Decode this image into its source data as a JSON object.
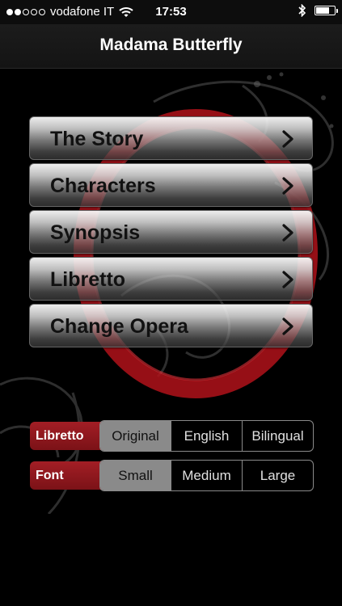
{
  "status_bar": {
    "carrier": "vodafone IT",
    "time": "17:53",
    "signal_bars_filled": 2,
    "signal_bars_total": 5,
    "battery_level": 0.75,
    "icons": [
      "wifi-icon",
      "bluetooth-icon",
      "battery-icon"
    ]
  },
  "nav": {
    "title": "Madama Butterfly"
  },
  "menu": {
    "items": [
      {
        "label": "The Story"
      },
      {
        "label": "Characters"
      },
      {
        "label": "Synopsis"
      },
      {
        "label": "Libretto"
      },
      {
        "label": "Change Opera"
      }
    ]
  },
  "settings": {
    "libretto": {
      "label": "Libretto",
      "options": [
        "Original",
        "English",
        "Bilingual"
      ],
      "selected": "Original"
    },
    "font": {
      "label": "Font",
      "options": [
        "Small",
        "Medium",
        "Large"
      ],
      "selected": "Small"
    }
  },
  "colors": {
    "accent_red": "#a31e25",
    "background": "#000000",
    "segment_selected": "#8a8a8a"
  }
}
